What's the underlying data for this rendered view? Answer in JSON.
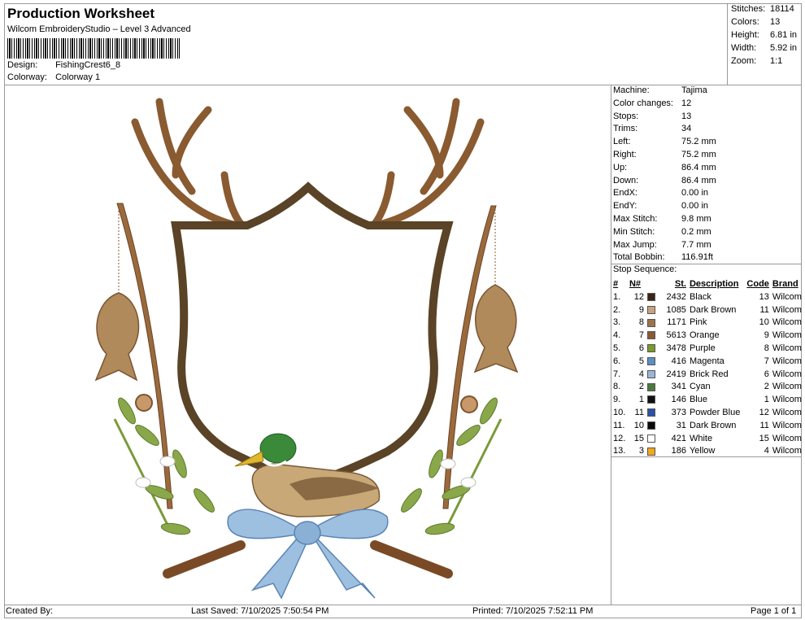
{
  "header": {
    "title": "Production Worksheet",
    "software": "Wilcom EmbroideryStudio – Level 3 Advanced",
    "design_label": "Design:",
    "design_value": "FishingCrest6_8",
    "colorway_label": "Colorway:",
    "colorway_value": "Colorway 1"
  },
  "summary": [
    {
      "label": "Stitches:",
      "value": "18114"
    },
    {
      "label": "Colors:",
      "value": "13"
    },
    {
      "label": "Height:",
      "value": "6.81 in"
    },
    {
      "label": "Width:",
      "value": "5.92 in"
    },
    {
      "label": "Zoom:",
      "value": "1:1"
    }
  ],
  "parameters": [
    {
      "label": "Machine:",
      "value": "Tajima"
    },
    {
      "label": "Color changes:",
      "value": "12"
    },
    {
      "label": "Stops:",
      "value": "13"
    },
    {
      "label": "Trims:",
      "value": "34"
    },
    {
      "label": "Left:",
      "value": "75.2 mm"
    },
    {
      "label": "Right:",
      "value": "75.2 mm"
    },
    {
      "label": "Up:",
      "value": "86.4 mm"
    },
    {
      "label": "Down:",
      "value": "86.4 mm"
    },
    {
      "label": "EndX:",
      "value": "0.00 in"
    },
    {
      "label": "EndY:",
      "value": "0.00 in"
    },
    {
      "label": "Max Stitch:",
      "value": "9.8 mm"
    },
    {
      "label": "Min Stitch:",
      "value": "0.2 mm"
    },
    {
      "label": "Max Jump:",
      "value": "7.7 mm"
    },
    {
      "label": "Total Bobbin:",
      "value": "116.91ft"
    }
  ],
  "stop_sequence": {
    "caption": "Stop Sequence:",
    "headers": {
      "num": "#",
      "n": "N#",
      "st": "St.",
      "desc": "Description",
      "code": "Code",
      "brand": "Brand"
    },
    "rows": [
      {
        "num": "1.",
        "n": "12",
        "color": "#3a2418",
        "st": "2432",
        "desc": "Black",
        "code": "13",
        "brand": "Wilcom"
      },
      {
        "num": "2.",
        "n": "9",
        "color": "#c9a27e",
        "st": "1085",
        "desc": "Dark Brown",
        "code": "11",
        "brand": "Wilcom"
      },
      {
        "num": "3.",
        "n": "8",
        "color": "#a0724a",
        "st": "1171",
        "desc": "Pink",
        "code": "10",
        "brand": "Wilcom"
      },
      {
        "num": "4.",
        "n": "7",
        "color": "#8a5a36",
        "st": "5613",
        "desc": "Orange",
        "code": "9",
        "brand": "Wilcom"
      },
      {
        "num": "5.",
        "n": "6",
        "color": "#7a9a2a",
        "st": "3478",
        "desc": "Purple",
        "code": "8",
        "brand": "Wilcom"
      },
      {
        "num": "6.",
        "n": "5",
        "color": "#5b8fc6",
        "st": "416",
        "desc": "Magenta",
        "code": "7",
        "brand": "Wilcom"
      },
      {
        "num": "7.",
        "n": "4",
        "color": "#9ab6d6",
        "st": "2419",
        "desc": "Brick Red",
        "code": "6",
        "brand": "Wilcom"
      },
      {
        "num": "8.",
        "n": "2",
        "color": "#4a7a3a",
        "st": "341",
        "desc": "Cyan",
        "code": "2",
        "brand": "Wilcom"
      },
      {
        "num": "9.",
        "n": "1",
        "color": "#111111",
        "st": "146",
        "desc": "Blue",
        "code": "1",
        "brand": "Wilcom"
      },
      {
        "num": "10.",
        "n": "11",
        "color": "#2a52a6",
        "st": "373",
        "desc": "Powder Blue",
        "code": "12",
        "brand": "Wilcom"
      },
      {
        "num": "11.",
        "n": "10",
        "color": "#0a0a0a",
        "st": "31",
        "desc": "Dark Brown",
        "code": "11",
        "brand": "Wilcom"
      },
      {
        "num": "12.",
        "n": "15",
        "color": "#ffffff",
        "st": "421",
        "desc": "White",
        "code": "15",
        "brand": "Wilcom"
      },
      {
        "num": "13.",
        "n": "3",
        "color": "#f2a81a",
        "st": "186",
        "desc": "Yellow",
        "code": "4",
        "brand": "Wilcom"
      }
    ]
  },
  "footer": {
    "created": "Created By:",
    "saved": "Last Saved: 7/10/2025 7:50:54 PM",
    "printed": "Printed: 7/10/2025 7:52:11 PM",
    "page": "Page 1 of 1"
  }
}
